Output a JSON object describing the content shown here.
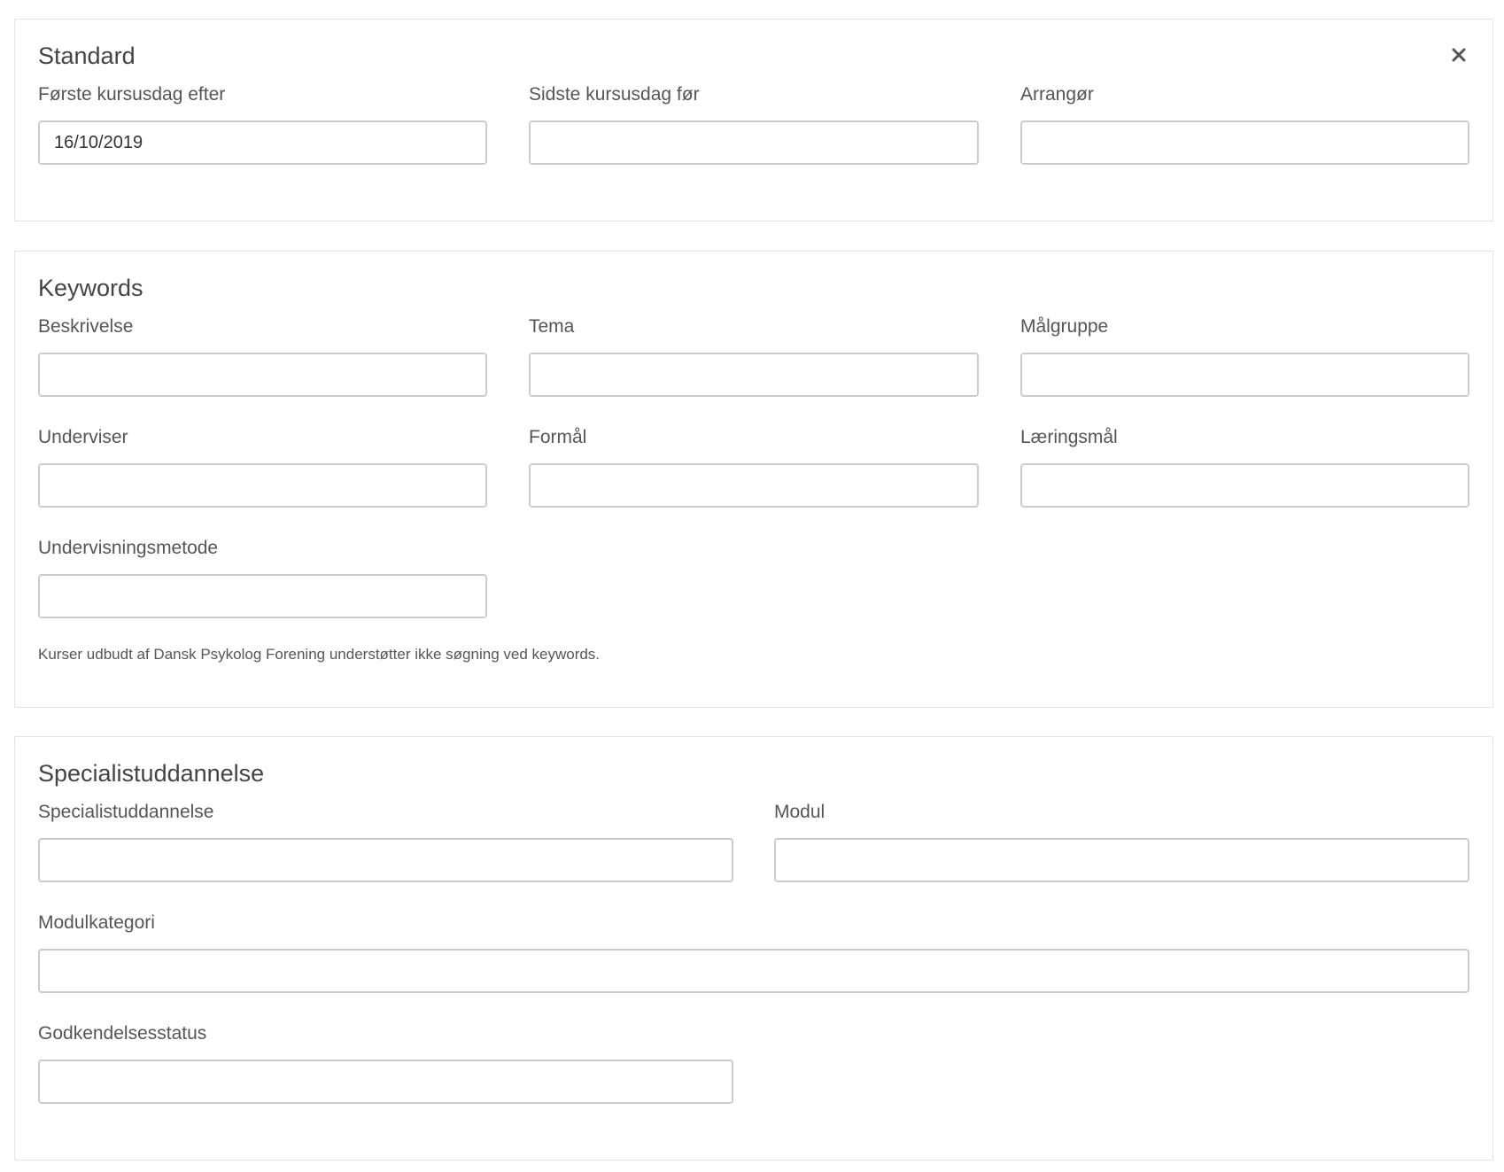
{
  "standard": {
    "title": "Standard",
    "close_icon": "close-icon",
    "first_day_label": "Første kursusdag efter",
    "first_day_value": "16/10/2019",
    "last_day_label": "Sidste kursusdag før",
    "last_day_value": "",
    "organizer_label": "Arrangør",
    "organizer_value": ""
  },
  "keywords": {
    "title": "Keywords",
    "description_label": "Beskrivelse",
    "theme_label": "Tema",
    "target_group_label": "Målgruppe",
    "teacher_label": "Underviser",
    "purpose_label": "Formål",
    "learning_goal_label": "Læringsmål",
    "teaching_method_label": "Undervisningsmetode",
    "note": "Kurser udbudt af Dansk Psykolog Forening understøtter ikke søgning ved keywords."
  },
  "specialist": {
    "title": "Specialistuddannelse",
    "specialist_label": "Specialistuddannelse",
    "module_label": "Modul",
    "module_category_label": "Modulkategori",
    "approval_status_label": "Godkendelsesstatus"
  }
}
